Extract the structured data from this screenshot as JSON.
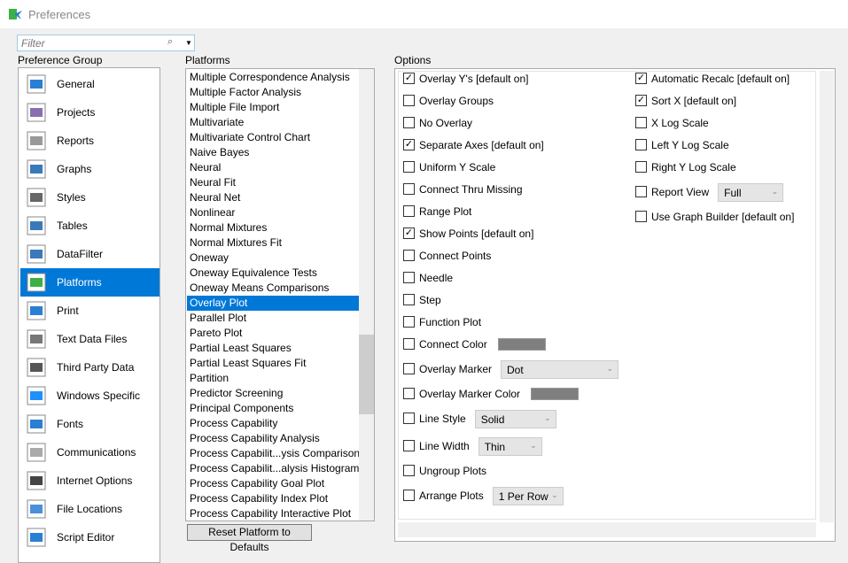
{
  "window": {
    "title": "Preferences"
  },
  "filter": {
    "placeholder": "Filter"
  },
  "preference_group": {
    "label": "Preference Group",
    "selected": "Platforms",
    "items": [
      "General",
      "Projects",
      "Reports",
      "Graphs",
      "Styles",
      "Tables",
      "DataFilter",
      "Platforms",
      "Print",
      "Text Data Files",
      "Third Party Data",
      "Windows Specific",
      "Fonts",
      "Communications",
      "Internet Options",
      "File Locations",
      "Script Editor"
    ]
  },
  "platforms": {
    "label": "Platforms",
    "selected": "Overlay Plot",
    "items": [
      "Multiple Correspondence Analysis",
      "Multiple Factor Analysis",
      "Multiple File Import",
      "Multivariate",
      "Multivariate Control Chart",
      "Naive Bayes",
      "Neural",
      "Neural Fit",
      "Neural Net",
      "Nonlinear",
      "Normal Mixtures",
      "Normal Mixtures Fit",
      "Oneway",
      "Oneway Equivalence Tests",
      "Oneway Means Comparisons",
      "Overlay Plot",
      "Parallel Plot",
      "Pareto Plot",
      "Partial Least Squares",
      "Partial Least Squares Fit",
      "Partition",
      "Predictor Screening",
      "Principal Components",
      "Process Capability",
      "Process Capability Analysis",
      "Process Capabilit...ysis Comparisons",
      "Process Capabilit...alysis Histogram",
      "Process Capability Goal Plot",
      "Process Capability Index Plot",
      "Process Capability Interactive Plot"
    ],
    "reset_button": "Reset Platform to Defaults"
  },
  "options": {
    "label": "Options",
    "left": [
      {
        "label": "Overlay Y's [default on]",
        "checked": true
      },
      {
        "label": "Overlay Groups",
        "checked": false
      },
      {
        "label": "No Overlay",
        "checked": false
      },
      {
        "label": "Separate Axes [default on]",
        "checked": true
      },
      {
        "label": "Uniform Y Scale",
        "checked": false
      },
      {
        "label": "Connect Thru Missing",
        "checked": false
      },
      {
        "label": "Range Plot",
        "checked": false
      },
      {
        "label": "Show Points [default on]",
        "checked": true
      },
      {
        "label": "Connect Points",
        "checked": false
      },
      {
        "label": "Needle",
        "checked": false
      },
      {
        "label": "Step",
        "checked": false
      },
      {
        "label": "Function Plot",
        "checked": false
      },
      {
        "label": "Connect Color",
        "checked": false,
        "color": "#7f7f7f"
      },
      {
        "label": "Overlay Marker",
        "checked": false,
        "select": "Dot"
      },
      {
        "label": "Overlay Marker Color",
        "checked": false,
        "color": "#7f7f7f"
      },
      {
        "label": "Line Style",
        "checked": false,
        "select": "Solid"
      },
      {
        "label": "Line Width",
        "checked": false,
        "select": "Thin"
      },
      {
        "label": "Ungroup Plots",
        "checked": false
      },
      {
        "label": "Arrange Plots",
        "checked": false,
        "select": "1 Per Row"
      }
    ],
    "right": [
      {
        "label": "Automatic Recalc [default on]",
        "checked": true
      },
      {
        "label": "Sort X [default on]",
        "checked": true
      },
      {
        "label": "X Log Scale",
        "checked": false
      },
      {
        "label": "Left Y Log Scale",
        "checked": false
      },
      {
        "label": "Right Y Log Scale",
        "checked": false
      },
      {
        "label": "Report View",
        "checked": false,
        "select": "Full"
      },
      {
        "label": "Use Graph Builder [default on]",
        "checked": false
      }
    ]
  }
}
